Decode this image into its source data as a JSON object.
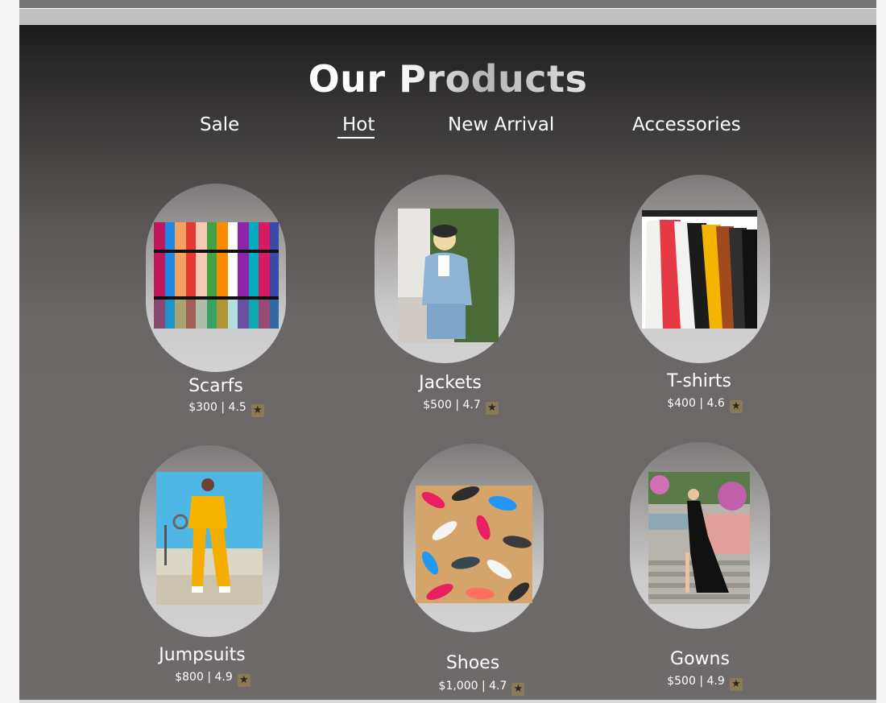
{
  "section": {
    "title": "Our Products"
  },
  "tabs": [
    {
      "label": "Sale",
      "active": false
    },
    {
      "label": "Hot",
      "active": true
    },
    {
      "label": "New Arrival",
      "active": false
    },
    {
      "label": "Accessories",
      "active": false
    }
  ],
  "products": [
    {
      "name": "Scarfs",
      "price": "$300",
      "rating": "4.5",
      "photo": "colorful-scarves-photo"
    },
    {
      "name": "Jackets",
      "price": "$500",
      "rating": "4.7",
      "photo": "denim-jacket-model-photo"
    },
    {
      "name": "T-shirts",
      "price": "$400",
      "rating": "4.6",
      "photo": "tshirts-on-rack-photo"
    },
    {
      "name": "Jumpsuits",
      "price": "$800",
      "rating": "4.9",
      "photo": "yellow-jumpsuit-model-photo"
    },
    {
      "name": "Shoes",
      "price": "$1,000",
      "rating": "4.7",
      "photo": "sneakers-flatlay-photo"
    },
    {
      "name": "Gowns",
      "price": "$500",
      "rating": "4.9",
      "photo": "black-gown-model-photo"
    }
  ],
  "rating_icon": "star-icon",
  "colors": {
    "background_top": "#1c1c1c",
    "background_bottom": "#6e6a6a",
    "text": "#ffffff",
    "star_badge": "#8a7b57"
  }
}
